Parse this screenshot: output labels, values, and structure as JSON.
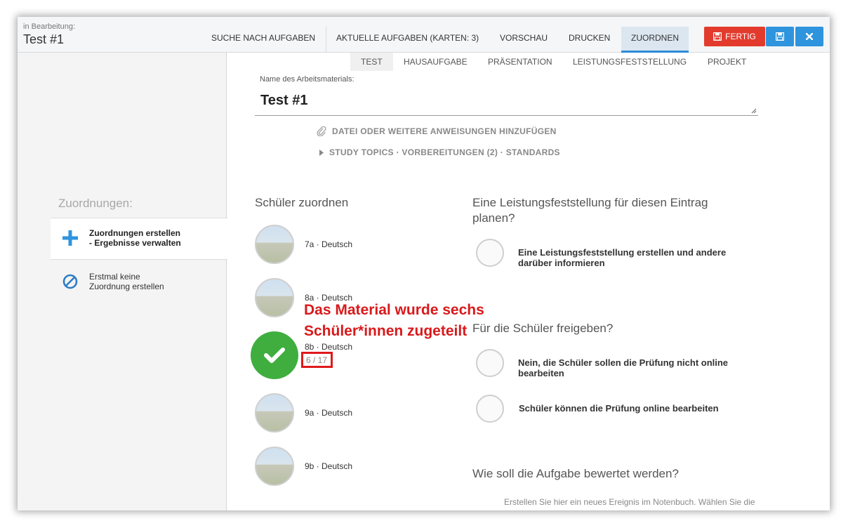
{
  "header": {
    "edit_label": "in Bearbeitung:",
    "title": "Test #1",
    "nav": [
      "SUCHE NACH AUFGABEN",
      "AKTUELLE AUFGABEN (KARTEN: 3)",
      "VORSCHAU",
      "DRUCKEN",
      "ZUORDNEN"
    ],
    "fertig_label": "FERTIG",
    "save_icon": "save-icon",
    "close_icon": "close-icon",
    "colors": {
      "red": "#e23b2e",
      "blue": "#2e94de",
      "active_tab": "#2e8bd8"
    }
  },
  "subtabs": [
    "TEST",
    "HAUSAUFGABE",
    "PRÄSENTATION",
    "LEISTUNGSFESTSTELLUNG",
    "PROJEKT"
  ],
  "form": {
    "name_label": "Name des Arbeitsmaterials:",
    "name_value": "Test #1",
    "attach_link": "DATEI ODER WEITERE ANWEISUNGEN HINZUFÜGEN",
    "topics_link": "STUDY TOPICS · VORBEREITUNGEN (2) · STANDARDS"
  },
  "sidebar": {
    "title": "Zuordnungen:",
    "items": [
      {
        "line1": "Zuordnungen erstellen",
        "line2": "- Ergebnisse verwalten"
      },
      {
        "line1": "Erstmal keine",
        "line2": "Zuordnung erstellen"
      }
    ]
  },
  "students": {
    "heading": "Schüler zuordnen",
    "classes": [
      "7a · Deutsch",
      "8a · Deutsch",
      "8b · Deutsch",
      "9a · Deutsch",
      "9b · Deutsch"
    ],
    "selected_count": "6 / 17"
  },
  "annotation": {
    "line1": "Das Material wurde sechs",
    "line2": "Schüler*innen zugeteilt",
    "color": "#d9191b"
  },
  "assessment": {
    "heading": "Eine Leistungsfeststellung für diesen Eintrag planen?",
    "option1": "Eine Leistungsfeststellung erstellen und andere darüber informieren"
  },
  "release": {
    "heading": "Für die Schüler freigeben?",
    "option1": "Nein, die Schüler sollen die Prüfung nicht online bearbeiten",
    "option2": "Schüler können die Prüfung online bearbeiten"
  },
  "grading": {
    "heading": "Wie soll die Aufgabe bewertet werden?",
    "text": "Erstellen Sie hier ein neues Ereignis im Notenbuch. Wählen Sie die"
  }
}
